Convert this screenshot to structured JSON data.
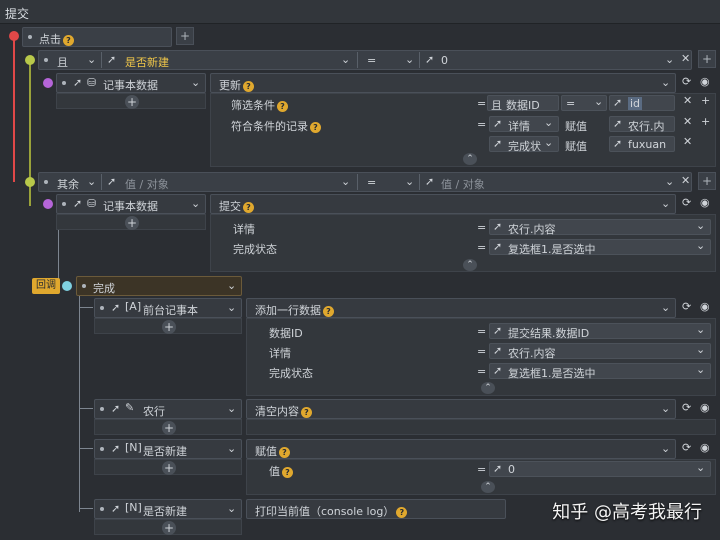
{
  "window_title": "提交",
  "click": {
    "label": "点击"
  },
  "if_row": {
    "logic": "且",
    "var": "是否新建",
    "op": "=",
    "val": "0"
  },
  "notebook_data_label": "记事本数据",
  "update_block": {
    "action": "更新",
    "filter_label": "筛选条件",
    "filter_logic": "且",
    "filter_field": "数据ID",
    "filter_op": "=",
    "filter_val": "id",
    "records_label": "符合条件的记录",
    "rec1_field": "详情",
    "rec1_op": "赋值",
    "rec1_val": "农行.内",
    "rec2_field": "完成状",
    "rec2_op": "赋值",
    "rec2_val": "fuxuan"
  },
  "else_row": {
    "label": "其余",
    "placeholder1": "值 / 对象",
    "op": "=",
    "placeholder2": "值 / 对象"
  },
  "submit_block": {
    "action": "提交",
    "row1_label": "详情",
    "row1_val": "农行.内容",
    "row2_label": "完成状态",
    "row2_val": "复选框1.是否选中"
  },
  "callback": {
    "tag": "回调",
    "label": "完成"
  },
  "front_notebook": {
    "target": "前台记事本",
    "action": "添加一行数据",
    "row1_label": "数据ID",
    "row1_val": "提交结果.数据ID",
    "row2_label": "详情",
    "row2_val": "农行.内容",
    "row3_label": "完成状态",
    "row3_val": "复选框1.是否选中"
  },
  "nonghang": {
    "target": "农行",
    "action": "清空内容"
  },
  "isnew_assign": {
    "target": "是否新建",
    "action": "赋值",
    "row_label": "值",
    "row_val": "0"
  },
  "isnew_log": {
    "target": "是否新建",
    "action": "打印当前值（console log）"
  },
  "watermark": "知乎 @高考我最行",
  "colors": {
    "accent": "#e0a82e",
    "red": "#e04848",
    "yellowgreen": "#b8c84a",
    "purple": "#b565d8",
    "cyan": "#7fd0e0"
  }
}
